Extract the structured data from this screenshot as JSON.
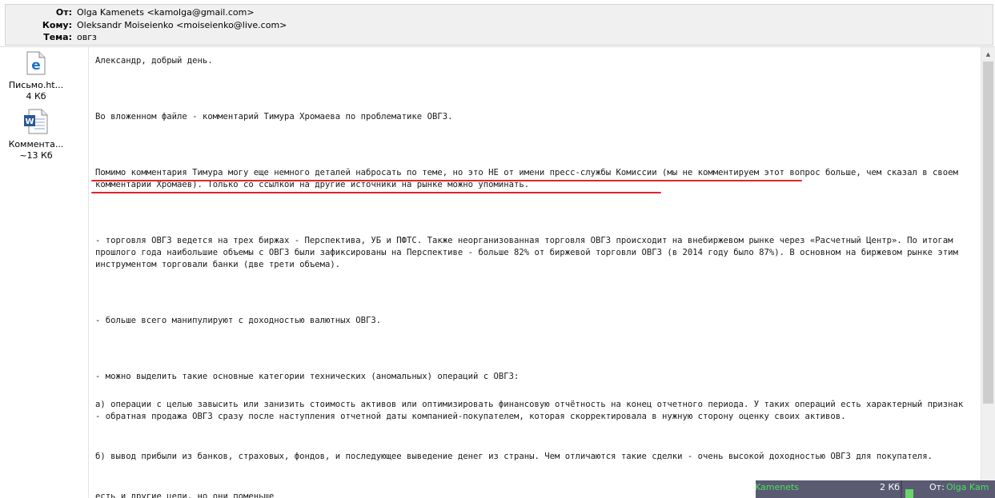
{
  "header": {
    "from_label": "От:",
    "from_value": "Olga Kamenets <kamolga@gmail.com>",
    "to_label": "Кому:",
    "to_value": "Oleksandr Moiseienko <moiseienko@live.com>",
    "subject_label": "Тема:",
    "subject_value": "овгз"
  },
  "attachments": [
    {
      "name": "Письмо.ht...",
      "size": "4 Кб",
      "icon": "ie-html-icon"
    },
    {
      "name": "Коммента...",
      "size": "~13 Кб",
      "icon": "word-doc-icon"
    }
  ],
  "message": {
    "p1": "Александр, добрый день.",
    "p2": "Во вложенном файле - комментарий Тимура Хромаева по проблематике ОВГЗ.",
    "p3": "Помимо комментария Тимура могу еще немного деталей набросать по теме, но это НЕ от имени пресс-службы Комиссии (мы не комментируем этот вопрос больше, чем сказал в своем комментарии Хромаев). Только со ссылкой на другие источники на рынке можно упоминать.",
    "p4": "- торговля ОВГЗ ведется на трех биржах - Перспектива, УБ и ПФТС. Также неорганизованная торговля ОВГЗ происходит на внебиржевом рынке через «Расчетный Центр». По итогам прошлого года наибольшие объемы с ОВГЗ были зафиксированы на Перспективе - больше 82% от биржевой торговли ОВГЗ (в 2014 году было 87%). В основном на биржевом рынке этим инструментом торговали банки (две трети объема).",
    "p5": "- больше всего манипулируют с доходностью валютных ОВГЗ.",
    "p6": "- можно выделить такие основные категории технических (аномальных) операций с ОВГЗ:",
    "p7": "а) операции с целью завысить или занизить стоимость активов или оптимизировать финансовую отчётность на конец отчетного периода. У таких операций есть характерный признак - обратная продажа ОВГЗ сразу после наступления отчетной даты компанией-покупателем, которая скорректировала в нужную сторону оценку своих активов.",
    "p8": "б) вывод прибыли из банков, страховых, фондов, и последующее выведение денег из страны. Чем отличаются такие сделки - очень высокой доходностью ОВГЗ для покупателя.",
    "p9": "есть и другие цели, но они поменьше"
  },
  "notification": {
    "sender": "Kamenets",
    "size": "2 Кб",
    "from_label": "От:",
    "from_value": "Olga Kam"
  },
  "colors": {
    "underline": "#e4242a",
    "notif_bg": "#5a5a72",
    "notif_green": "#47e05f"
  }
}
